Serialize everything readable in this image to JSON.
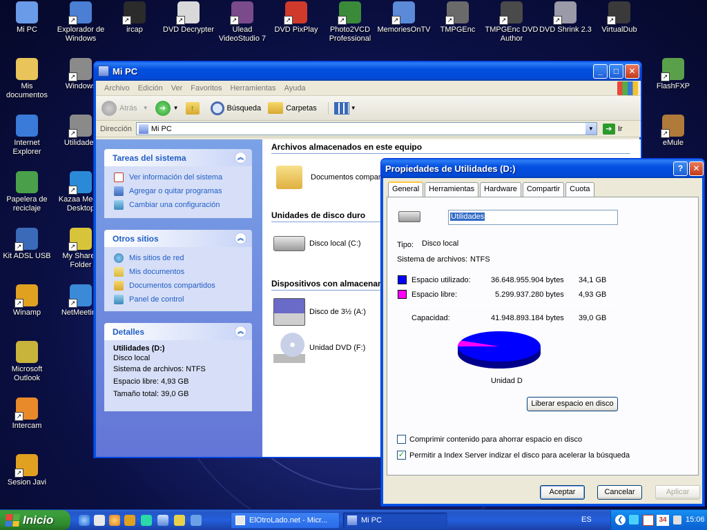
{
  "desktop": {
    "icons": [
      {
        "label": "Mi PC",
        "color": "#6a9be8"
      },
      {
        "label": "Explorador de Windows",
        "color": "#4a7fd4"
      },
      {
        "label": "ircap",
        "color": "#2b2b2b"
      },
      {
        "label": "DVD Decrypter",
        "color": "#d9d9d9"
      },
      {
        "label": "Ulead VideoStudio 7",
        "color": "#7a4a8a"
      },
      {
        "label": "DVD PixPlay",
        "color": "#d03a2a"
      },
      {
        "label": "Photo2VCD Professional",
        "color": "#3a8a3a"
      },
      {
        "label": "MemoriesOnTV",
        "color": "#5a8ad8"
      },
      {
        "label": "TMPGEnc",
        "color": "#6a6a6a"
      },
      {
        "label": "TMPGEnc DVD Author",
        "color": "#4a4a4a"
      },
      {
        "label": "DVD Shrink 2.3",
        "color": "#9a9aa8"
      },
      {
        "label": "VirtualDub",
        "color": "#3a3a3a"
      },
      {
        "label": "Mis documentos",
        "color": "#e8c45a"
      },
      {
        "label": "Windows",
        "color": "#8a8a8a"
      },
      {
        "label": "FlashFXP",
        "color": "#5aa04a"
      },
      {
        "label": "Internet Explorer",
        "color": "#3a7ad8"
      },
      {
        "label": "Utilidades",
        "color": "#8a8a8a"
      },
      {
        "label": "eMule",
        "color": "#b07a3a"
      },
      {
        "label": "Papelera de reciclaje",
        "color": "#4aa04a"
      },
      {
        "label": "Kazaa Media Desktop",
        "color": "#2a8ad8"
      },
      {
        "label": "Kit ADSL USB",
        "color": "#3a6ab8"
      },
      {
        "label": "My Shared Folder",
        "color": "#d8c43a"
      },
      {
        "label": "Winamp",
        "color": "#e0a020"
      },
      {
        "label": "NetMeeting",
        "color": "#3a8ad8"
      },
      {
        "label": "Microsoft Outlook",
        "color": "#c8b43a"
      },
      {
        "label": "Intercam",
        "color": "#e88a2a"
      },
      {
        "label": "Sesion Javi",
        "color": "#e0a020"
      }
    ]
  },
  "mipc": {
    "title": "Mi PC",
    "menu": [
      "Archivo",
      "Edición",
      "Ver",
      "Favoritos",
      "Herramientas",
      "Ayuda"
    ],
    "toolbar": {
      "back": "Atrás",
      "search": "Búsqueda",
      "folders": "Carpetas"
    },
    "address_label": "Dirección",
    "address_value": "Mi PC",
    "go_label": "Ir",
    "tasks": {
      "title": "Tareas del sistema",
      "items": [
        "Ver información del sistema",
        "Agregar o quitar programas",
        "Cambiar una configuración"
      ]
    },
    "places": {
      "title": "Otros sitios",
      "items": [
        "Mis sitios de red",
        "Mis documentos",
        "Documentos compartidos",
        "Panel de control"
      ]
    },
    "details": {
      "title": "Detalles",
      "name": "Utilidades (D:)",
      "type": "Disco local",
      "fs": "Sistema de archivos: NTFS",
      "free": "Espacio libre: 4,93 GB",
      "total": "Tamaño total: 39,0 GB"
    },
    "sections": {
      "stored": "Archivos almacenados en este equipo",
      "disks": "Unidades de disco duro",
      "removable": "Dispositivos con almacenam"
    },
    "files": {
      "shared": "Documentos comparti",
      "local_c": "Disco local (C:)",
      "floppy": "Disco de 3½ (A:)",
      "dvd": "Unidad DVD (F:)"
    }
  },
  "props": {
    "title": "Propiedades de Utilidades (D:)",
    "tabs": [
      "General",
      "Herramientas",
      "Hardware",
      "Compartir",
      "Cuota"
    ],
    "volume_name": "Utilidades",
    "type_label": "Tipo:",
    "type_value": "Disco local",
    "fs_label": "Sistema de archivos:",
    "fs_value": "NTFS",
    "used_label": "Espacio utilizado:",
    "used_bytes": "36.648.955.904 bytes",
    "used_gb": "34,1 GB",
    "free_label": "Espacio libre:",
    "free_bytes": "5.299.937.280 bytes",
    "free_gb": "4,93 GB",
    "capacity_label": "Capacidad:",
    "capacity_bytes": "41.948.893.184 bytes",
    "capacity_gb": "39,0 GB",
    "used_color": "#0000ff",
    "free_color": "#ff00ff",
    "drive_label": "Unidad D",
    "cleanup_button": "Liberar espacio en disco",
    "compress_label": "Comprimir contenido para ahorrar espacio en disco",
    "index_label": "Permitir a Index Server indizar el disco para acelerar la búsqueda",
    "ok": "Aceptar",
    "cancel": "Cancelar",
    "apply": "Aplicar"
  },
  "taskbar": {
    "start": "Inicio",
    "tasks": [
      "ElOtroLado.net - Micr...",
      "Mi PC"
    ],
    "lang": "ES",
    "clock": "15:06",
    "tray_day": "34"
  }
}
